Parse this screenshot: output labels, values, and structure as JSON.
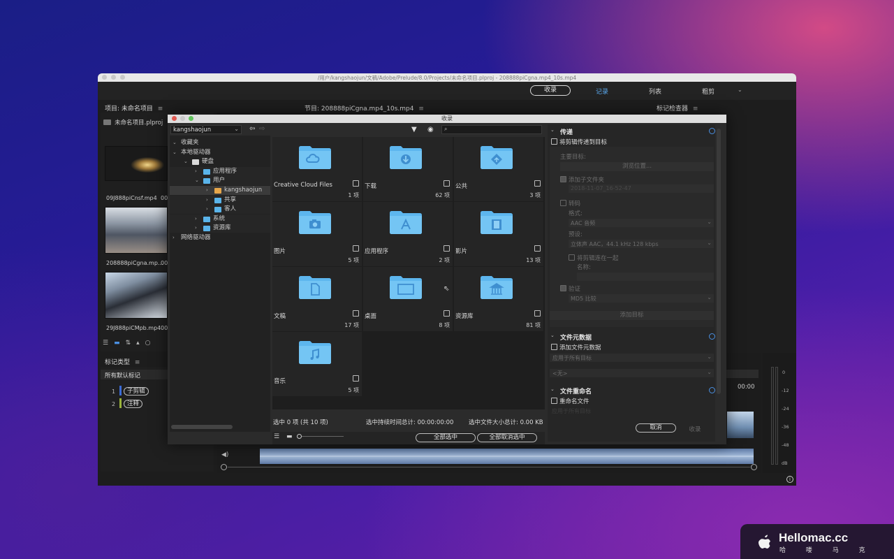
{
  "window": {
    "path": "/用户/kangshaojun/文稿/Adobe/Prelude/8.0/Projects/未命名项目.plproj - 208888piCgna.mp4_10s.mp4"
  },
  "workspace": {
    "ingest_label": "收录",
    "tabs": [
      "记录",
      "列表",
      "粗剪"
    ],
    "more_icon": "chevron-down-icon"
  },
  "project_panel": {
    "title": "项目: 未命名项目",
    "project_file": "未命名项目.plproj",
    "clips": [
      {
        "name": "09J888piCnsf.mp4",
        "duration": "00:"
      },
      {
        "name": "208888piCgna.mp...",
        "duration": "00:"
      },
      {
        "name": "29J888piCMpb.mp4",
        "duration": "00:"
      }
    ]
  },
  "timeline_panel": {
    "title": "节目: 208888piCgna.mp4_10s.mp4",
    "time": "00:00"
  },
  "marker_inspector": {
    "title": "标记检查器"
  },
  "marker_types": {
    "title": "标记类型",
    "category": "所有默认标记",
    "items": [
      {
        "num": "1",
        "label": "子剪辑",
        "color": "#3b6bd6"
      },
      {
        "num": "2",
        "label": "注释",
        "color": "#9ab23a"
      }
    ]
  },
  "audio_meter": {
    "ticks": [
      "0",
      "-12",
      "-24",
      "-36",
      "-48",
      "dB"
    ]
  },
  "dialog": {
    "title": "收录",
    "location": "kangshaojun",
    "tree": [
      {
        "label": "收藏夹",
        "indent": 0,
        "icon": false,
        "caret": "v"
      },
      {
        "label": "本地驱动器",
        "indent": 0,
        "icon": false,
        "caret": "v"
      },
      {
        "label": "硬盘",
        "indent": 1,
        "icon": true,
        "caret": "v"
      },
      {
        "label": "应用程序",
        "indent": 2,
        "icon": true,
        "caret": ">"
      },
      {
        "label": "用户",
        "indent": 2,
        "icon": true,
        "caret": "v"
      },
      {
        "label": "kangshaojun",
        "indent": 3,
        "icon": true,
        "caret": ">",
        "selected": true
      },
      {
        "label": "共享",
        "indent": 3,
        "icon": true,
        "caret": ">"
      },
      {
        "label": "客人",
        "indent": 3,
        "icon": true,
        "caret": ">"
      },
      {
        "label": "系统",
        "indent": 2,
        "icon": true,
        "caret": ">"
      },
      {
        "label": "资源库",
        "indent": 2,
        "icon": true,
        "caret": ">"
      },
      {
        "label": "网络驱动器",
        "indent": 0,
        "icon": false,
        "caret": ">"
      }
    ],
    "folders": [
      {
        "name": "Creative Cloud Files",
        "count": "1 项",
        "glyph": "cloud-icon"
      },
      {
        "name": "下载",
        "count": "62 项",
        "glyph": "download-icon"
      },
      {
        "name": "公共",
        "count": "3 项",
        "glyph": "public-icon"
      },
      {
        "name": "图片",
        "count": "5 项",
        "glyph": "camera-icon"
      },
      {
        "name": "应用程序",
        "count": "2 项",
        "glyph": "apps-icon"
      },
      {
        "name": "影片",
        "count": "13 项",
        "glyph": "film-icon"
      },
      {
        "name": "文稿",
        "count": "17 项",
        "glyph": "document-icon"
      },
      {
        "name": "桌面",
        "count": "8 项",
        "glyph": "desktop-icon"
      },
      {
        "name": "资源库",
        "count": "81 项",
        "glyph": "library-icon"
      },
      {
        "name": "音乐",
        "count": "5 项",
        "glyph": "music-icon"
      }
    ],
    "status": {
      "selected": "选中 0 项 (共 10 项)",
      "duration": "选中持续时间总计: 00:00:00:00",
      "size": "选中文件大小总计: 0.00 KB"
    },
    "select_all": "全部选中",
    "deselect_all": "全部取消选中",
    "transfer": {
      "title": "传递",
      "copy_check": "将剪辑传递到目标",
      "primary_dest": "主要目标:",
      "browse": "浏览位置...",
      "add_subfolder": "添加子文件夹",
      "subfolder_value": "2018-11-07_16-52-47",
      "transcode": "转码",
      "format_label": "格式:",
      "format_value": "AAC 音频",
      "preset_label": "预设:",
      "preset_value": "立体声 AAC，44.1 kHz 128 kbps",
      "join_clips": "将剪辑连在一起",
      "name_label": "名称:",
      "verify": "验证",
      "verify_value": "MD5 比较",
      "add_target": "添加目标"
    },
    "metadata": {
      "title": "文件元数据",
      "add_check": "添加文件元数据",
      "apply_value": "应用于所有目标",
      "template_value": "<无>"
    },
    "rename": {
      "title": "文件重命名",
      "rename_check": "重命名文件",
      "apply_value": "应用于所有目标"
    },
    "cancel": "取消",
    "ingest": "收录"
  },
  "brand": {
    "name": "Hellomac.cc",
    "sub": "哈 喽 马 克"
  }
}
